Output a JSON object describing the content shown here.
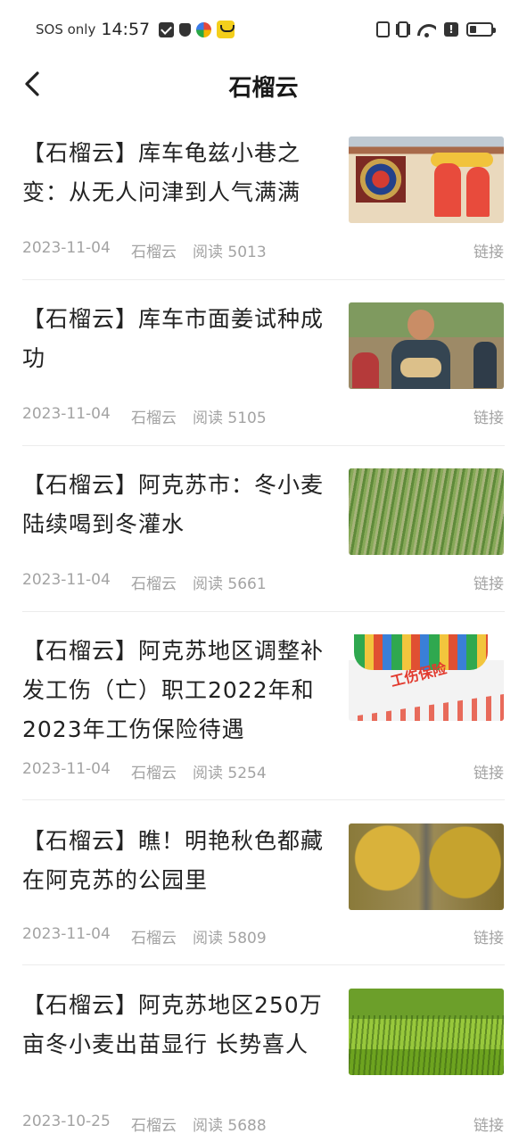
{
  "status_bar": {
    "carrier": "SOS only",
    "time": "14:57",
    "notification_icons": [
      "mail-icon",
      "shield-icon",
      "app-circle-icon",
      "app-yellow-icon"
    ],
    "system_icons": [
      "nfc-icon",
      "vibrate-icon",
      "wifi-icon",
      "alert-icon",
      "battery-icon"
    ]
  },
  "header": {
    "title": "石榴云",
    "back_icon": "chevron-left-icon"
  },
  "articles": [
    {
      "title": "【石榴云】库车龟兹小巷之变：从无人问津到人气满满",
      "date": "2023-11-04",
      "source": "石榴云",
      "reads": "阅读 5013",
      "link": "链接"
    },
    {
      "title": "【石榴云】库车市面姜试种成功",
      "date": "2023-11-04",
      "source": "石榴云",
      "reads": "阅读 5105",
      "link": "链接"
    },
    {
      "title": "【石榴云】阿克苏市：冬小麦陆续喝到冬灌水",
      "date": "2023-11-04",
      "source": "石榴云",
      "reads": "阅读 5661",
      "link": "链接"
    },
    {
      "title": "【石榴云】阿克苏地区调整补发工伤（亡）职工2022年和2023年工伤保险待遇",
      "date": "2023-11-04",
      "source": "石榴云",
      "reads": "阅读 5254",
      "link": "链接",
      "thumb_text": "工伤保险"
    },
    {
      "title": "【石榴云】瞧！明艳秋色都藏在阿克苏的公园里",
      "date": "2023-11-04",
      "source": "石榴云",
      "reads": "阅读 5809",
      "link": "链接"
    },
    {
      "title": "【石榴云】阿克苏地区250万亩冬小麦出苗显行 长势喜人",
      "date": "2023-10-25",
      "source": "石榴云",
      "reads": "阅读 5688",
      "link": "链接"
    }
  ]
}
